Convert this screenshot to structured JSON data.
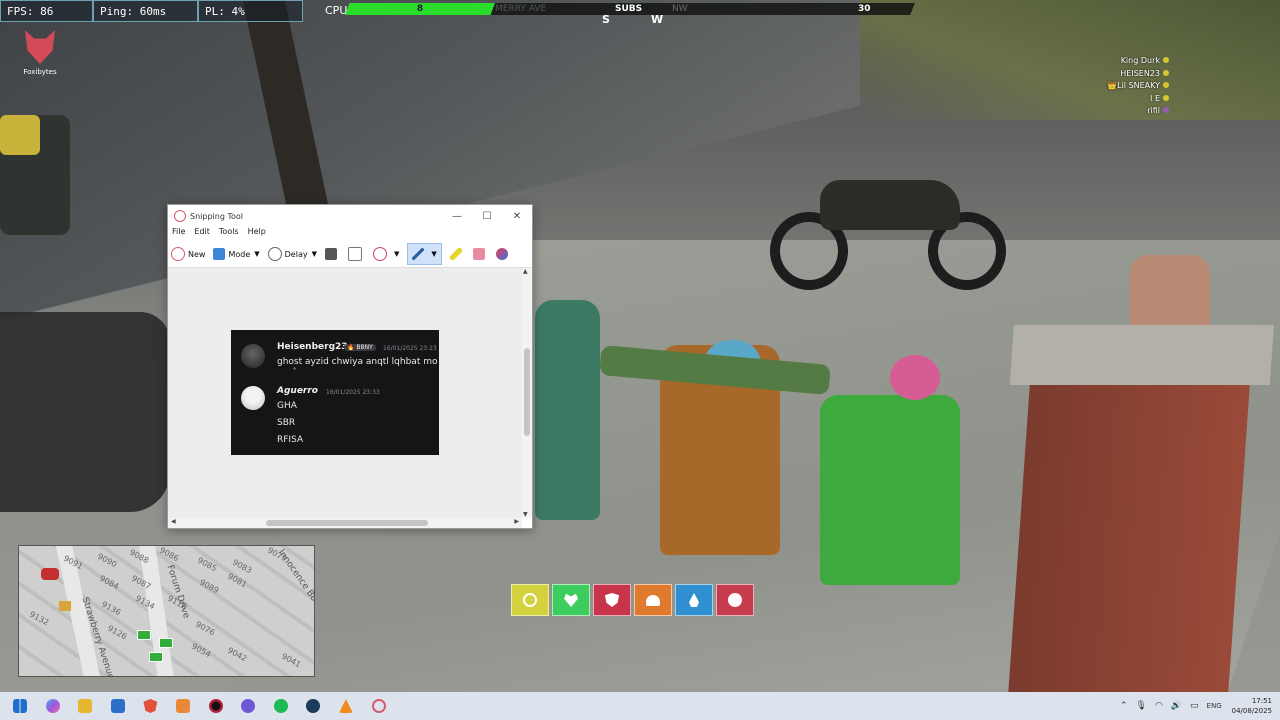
{
  "hud": {
    "fps": "FPS: 86",
    "ping": "Ping: 60ms",
    "pl": "PL: 4%",
    "cpu": "CPU",
    "health_value": "8",
    "street": "MERRY AVE",
    "zone": "SUBS",
    "compass_nw": "NW",
    "heading_value": "30",
    "dir_s": "S",
    "dir_w": "W"
  },
  "logo": {
    "text": "Foxibytes",
    "color": "#d34a5b"
  },
  "players": [
    {
      "name": "King Durk",
      "dot": "#d6c534"
    },
    {
      "name": "HEISEN23",
      "dot": "#d6c534"
    },
    {
      "name": "👑Lil SNEAKY",
      "dot": "#d6c534"
    },
    {
      "name": "l E",
      "dot": "#d6c534"
    },
    {
      "name": "rifil",
      "dot": "#9a5bb8"
    }
  ],
  "snipping_tool": {
    "title": "Snipping Tool",
    "controls": {
      "minimize": "—",
      "maximize": "☐",
      "close": "✕"
    },
    "menu": [
      "File",
      "Edit",
      "Tools",
      "Help"
    ],
    "toolbar": {
      "new": "New",
      "mode": "Mode",
      "delay": "Delay"
    },
    "chat": {
      "messages": [
        {
          "author": "Heisenberg23",
          "badge": "🔥 BBNY",
          "time": "16/01/2025 23:23",
          "lines": [
            "ghost ayzid chwiya anqtl lqhbat mo",
            "°"
          ]
        },
        {
          "author": "Aguerro",
          "time": "16/01/2025 23:33",
          "lines": [
            "GHA",
            "SBR",
            "RFISA"
          ]
        }
      ]
    }
  },
  "hotbar": [
    {
      "name": "stamina-slot",
      "color": "#d4d23c",
      "icon": "stamina-icon"
    },
    {
      "name": "health-slot",
      "color": "#3dcc5e",
      "icon": "heart-icon"
    },
    {
      "name": "armor-slot",
      "color": "#c8354a",
      "icon": "shield-icon"
    },
    {
      "name": "hunger-slot",
      "color": "#e07a2e",
      "icon": "burger-icon"
    },
    {
      "name": "thirst-slot",
      "color": "#2f8fd0",
      "icon": "water-drop-icon"
    },
    {
      "name": "stress-slot",
      "color": "#c83b4f",
      "icon": "brain-icon"
    }
  ],
  "minimap": {
    "labels": [
      "Strawberry Avenue",
      "Forum Drive",
      "Innocence Boulevard"
    ],
    "numbers": [
      "9091",
      "9090",
      "9088",
      "9086",
      "9085",
      "9083",
      "9081",
      "9084",
      "9087",
      "9089",
      "9136",
      "9134",
      "9132",
      "9116",
      "9126",
      "9076",
      "9042",
      "9041",
      "9054",
      "9079"
    ]
  },
  "taskbar": {
    "apps": [
      {
        "name": "windows-start-icon",
        "color": "#1f6fd0"
      },
      {
        "name": "copilot-icon",
        "color": "#7b5bd6"
      },
      {
        "name": "file-explorer-icon",
        "color": "#e7b52f"
      },
      {
        "name": "store-icon",
        "color": "#2c6fc9"
      },
      {
        "name": "brave-icon",
        "color": "#e2513a"
      },
      {
        "name": "archive-icon",
        "color": "#e8893a"
      },
      {
        "name": "app-red-black-icon",
        "color": "#b2203a"
      },
      {
        "name": "discord-icon",
        "color": "#6c58d4"
      },
      {
        "name": "spotify-icon",
        "color": "#1db954"
      },
      {
        "name": "steam-icon",
        "color": "#1b3a5c"
      },
      {
        "name": "vlc-icon",
        "color": "#f08a1a"
      },
      {
        "name": "snipping-tool-icon",
        "color": "#d85a6b"
      }
    ],
    "tray": {
      "chevron": "⌃",
      "mic": "🎙",
      "wifi": "◠",
      "volume": "🔊",
      "battery": "▭",
      "lang": "ENG",
      "time": "17:51",
      "date": "04/08/2025"
    }
  }
}
